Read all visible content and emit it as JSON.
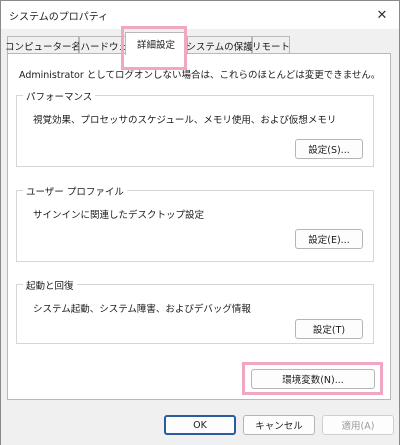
{
  "window": {
    "title": "システムのプロパティ",
    "close_glyph": "✕"
  },
  "tabs": [
    {
      "label": "コンピューター名",
      "active": false
    },
    {
      "label": "ハードウェア",
      "active": false
    },
    {
      "label": "詳細設定",
      "active": true
    },
    {
      "label": "システムの保護",
      "active": false
    },
    {
      "label": "リモート",
      "active": false
    }
  ],
  "advanced": {
    "intro": "Administrator としてログオンしない場合は、これらのほとんどは変更できません。",
    "performance": {
      "title": "パフォーマンス",
      "description": "視覚効果、プロセッサのスケジュール、メモリ使用、および仮想メモリ",
      "button": "設定(S)..."
    },
    "user_profile": {
      "title": "ユーザー プロファイル",
      "description": "サインインに関連したデスクトップ設定",
      "button": "設定(E)..."
    },
    "startup_recovery": {
      "title": "起動と回復",
      "description": "システム起動、システム障害、およびデバッグ情報",
      "button": "設定(T)"
    },
    "env_button": "環境変数(N)..."
  },
  "footer": {
    "ok": "OK",
    "cancel": "キャンセル",
    "apply": "適用(A)"
  },
  "colors": {
    "highlight": "#f0a7c4",
    "default_button_border": "#2a5d9f"
  }
}
